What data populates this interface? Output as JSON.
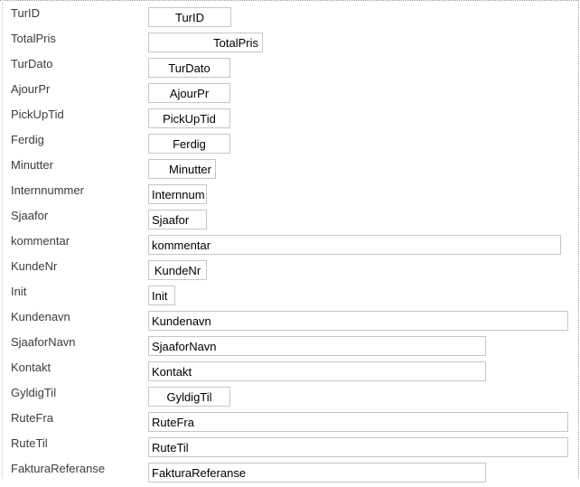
{
  "fields": [
    {
      "label": "TurID",
      "control": "TurID"
    },
    {
      "label": "TotalPris",
      "control": "TotalPris"
    },
    {
      "label": "TurDato",
      "control": "TurDato"
    },
    {
      "label": "AjourPr",
      "control": "AjourPr"
    },
    {
      "label": "PickUpTid",
      "control": "PickUpTid"
    },
    {
      "label": "Ferdig",
      "control": "Ferdig"
    },
    {
      "label": "Minutter",
      "control": "Minutter"
    },
    {
      "label": "Internnummer",
      "control": "Internnum"
    },
    {
      "label": "Sjaafor",
      "control": "Sjaafor"
    },
    {
      "label": "kommentar",
      "control": "kommentar"
    },
    {
      "label": "KundeNr",
      "control": "KundeNr"
    },
    {
      "label": "Init",
      "control": "Init"
    },
    {
      "label": "Kundenavn",
      "control": "Kundenavn"
    },
    {
      "label": "SjaaforNavn",
      "control": "SjaaforNavn"
    },
    {
      "label": "Kontakt",
      "control": "Kontakt"
    },
    {
      "label": "GyldigTil",
      "control": "GyldigTil"
    },
    {
      "label": "RuteFra",
      "control": "RuteFra"
    },
    {
      "label": "RuteTil",
      "control": "RuteTil"
    },
    {
      "label": "FakturaReferanse",
      "control": "FakturaReferanse"
    }
  ]
}
